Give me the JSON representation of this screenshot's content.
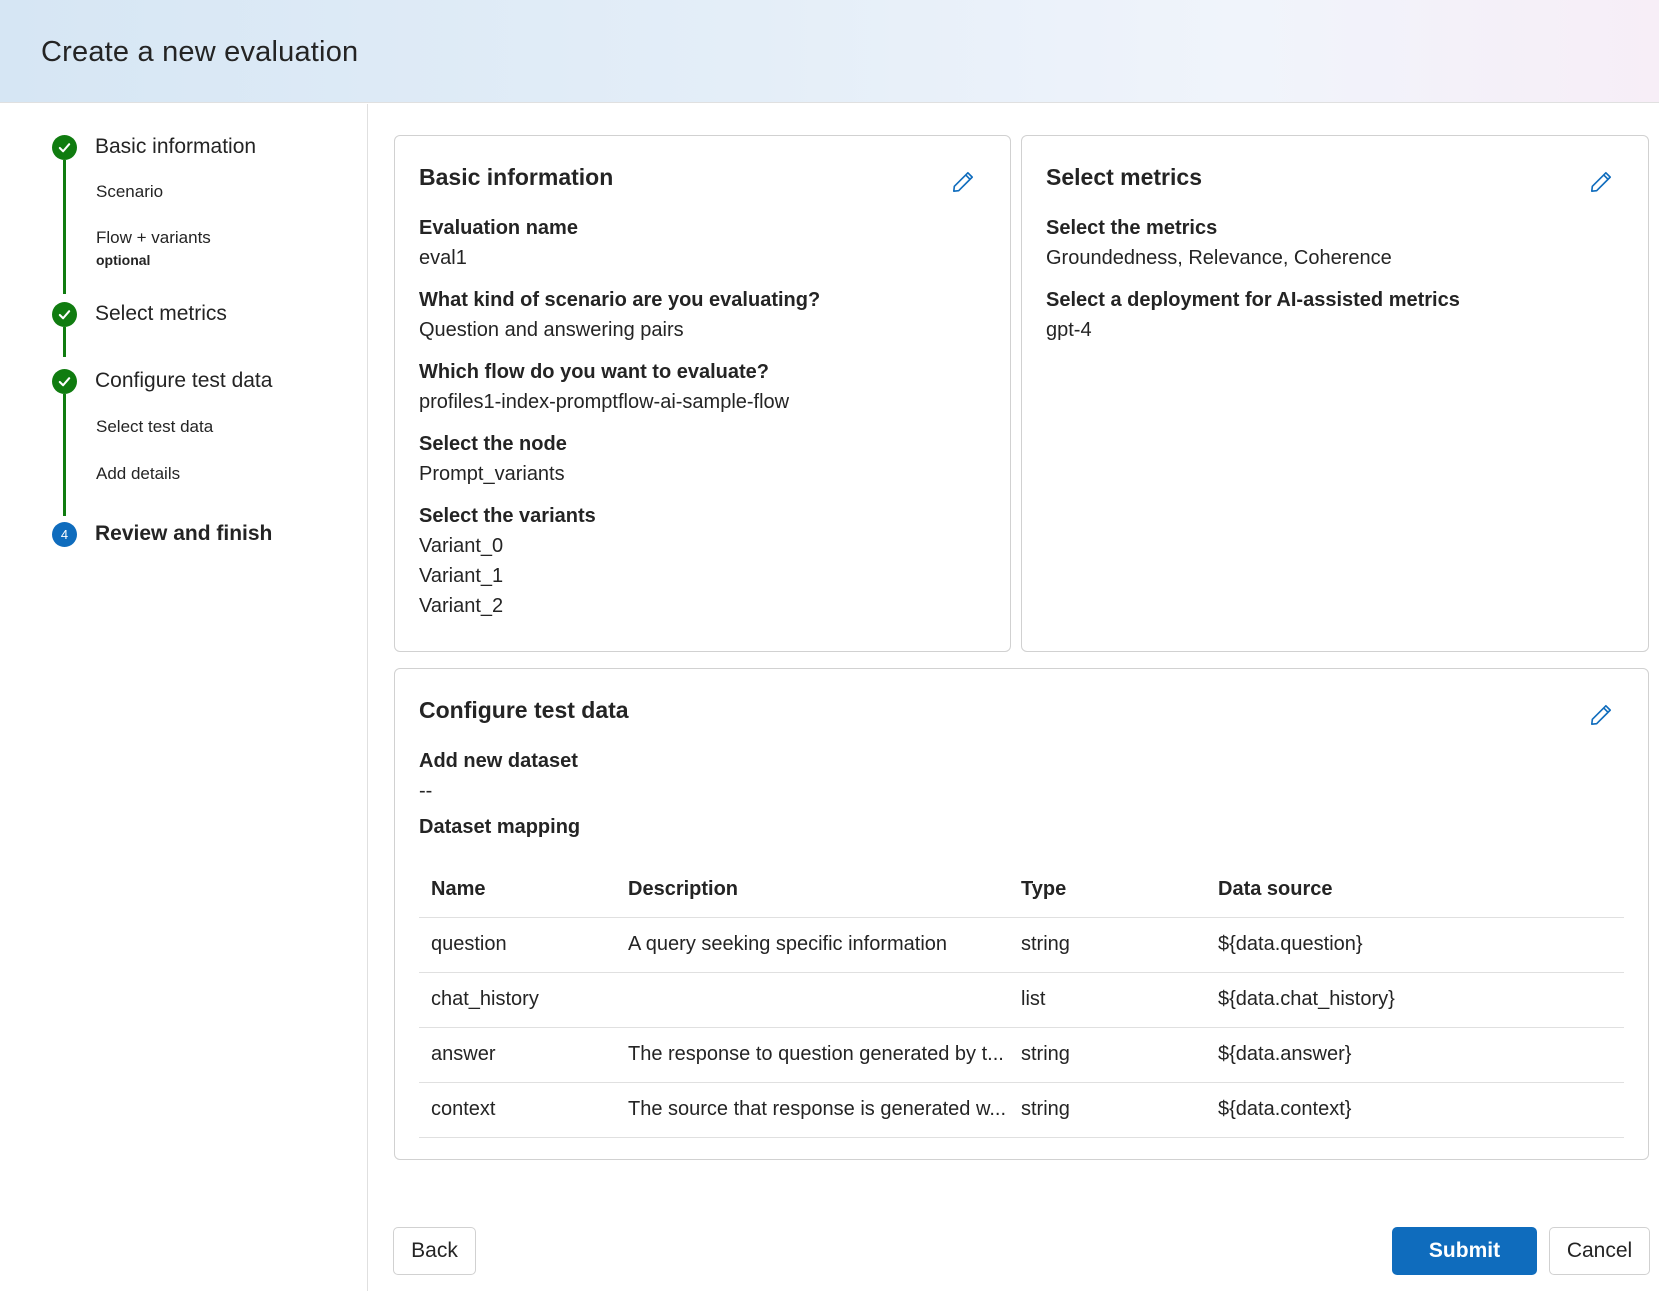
{
  "page": {
    "title": "Create a new evaluation"
  },
  "steps": {
    "basic": {
      "label": "Basic information",
      "scenario": "Scenario",
      "flow": "Flow + variants",
      "optional": "optional"
    },
    "metrics": {
      "label": "Select metrics"
    },
    "testdata": {
      "label": "Configure test data",
      "select": "Select test data",
      "details": "Add details"
    },
    "review": {
      "number": "4",
      "label": "Review and finish"
    }
  },
  "basic_card": {
    "title": "Basic information",
    "eval_name_label": "Evaluation name",
    "eval_name_value": "eval1",
    "scenario_label": "What kind of scenario are you evaluating?",
    "scenario_value": "Question and answering pairs",
    "flow_label": "Which flow do you want to evaluate?",
    "flow_value": "profiles1-index-promptflow-ai-sample-flow",
    "node_label": "Select the node",
    "node_value": "Prompt_variants",
    "variants_label": "Select the variants",
    "variants": [
      "Variant_0",
      "Variant_1",
      "Variant_2"
    ]
  },
  "metrics_card": {
    "title": "Select metrics",
    "metrics_label": "Select the metrics",
    "metrics_value": "Groundedness, Relevance, Coherence",
    "deployment_label": "Select a deployment for AI-assisted metrics",
    "deployment_value": "gpt-4"
  },
  "testdata_card": {
    "title": "Configure test data",
    "dataset_label": "Add new dataset",
    "dataset_value": "--",
    "mapping_label": "Dataset mapping",
    "columns": [
      "Name",
      "Description",
      "Type",
      "Data source"
    ],
    "rows": [
      [
        "question",
        "A query seeking specific information",
        "string",
        "${data.question}"
      ],
      [
        "chat_history",
        "",
        "list",
        "${data.chat_history}"
      ],
      [
        "answer",
        "The response to question generated by t...",
        "string",
        "${data.answer}"
      ],
      [
        "context",
        "The source that response is generated w...",
        "string",
        "${data.context}"
      ]
    ]
  },
  "buttons": {
    "back": "Back",
    "submit": "Submit",
    "cancel": "Cancel"
  },
  "colors": {
    "success": "#107c10",
    "brand": "#0f6cbd",
    "border": "#d1d1d1"
  },
  "icons": {
    "step_done": "checkmark-icon",
    "edit": "pencil-icon"
  }
}
